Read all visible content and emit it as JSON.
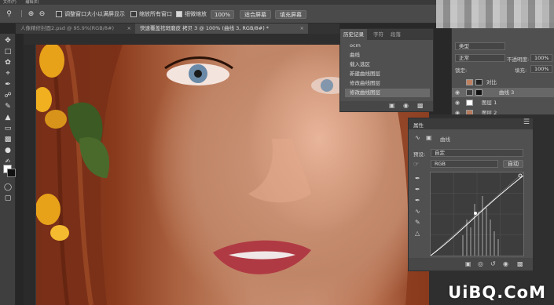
{
  "menubar": {
    "items": [
      "文件(F)",
      "编辑(E)"
    ]
  },
  "options": {
    "resize_windows_label": "调整窗口大小以满屏显示",
    "zoom_all_label": "缩放所有窗口",
    "scrubby_zoom_label": "细微缩放",
    "zoom_value": "100%",
    "fit_screen_label": "适合屏幕",
    "fill_screen_label": "填充屏幕"
  },
  "tabs": [
    {
      "label": "人像精修封面2.psd @ 95.9%(RGB/8#)",
      "close": "×"
    },
    {
      "label": "快速覆盖祛斑磨皮 拷贝 3 @ 100% (曲线 3, RGB/8#) *",
      "close": "×"
    }
  ],
  "history": {
    "tabs": [
      "历史记录",
      "字符",
      "段落"
    ],
    "rows": [
      "ocm",
      "曲线",
      "载入选区",
      "新建曲线图层",
      "修改曲线图层",
      "修改曲线图层"
    ],
    "active_index": 5
  },
  "layers": {
    "search_value": "类型",
    "blend_mode": "正常",
    "opacity_label": "不透明度:",
    "opacity_value": "100%",
    "lock_label": "锁定:",
    "fill_label": "填充:",
    "fill_value": "100%",
    "rows": [
      {
        "name": "对比",
        "visible": false
      },
      {
        "name": "曲线 3",
        "visible": true,
        "active": true
      },
      {
        "name": "图层 1",
        "visible": true
      },
      {
        "name": "图层 2",
        "visible": true
      }
    ]
  },
  "properties": {
    "title": "属性",
    "adjustment_label": "曲线",
    "preset_label": "预设:",
    "preset_value": "自定",
    "channel_value": "RGB",
    "auto_label": "自动"
  },
  "watermark": "UiBQ.CoM",
  "colors": {
    "panel_bg": "#505050",
    "options_bg": "#4a4a4a",
    "app_bg": "#282828",
    "foreground_swatch": "#ffffff",
    "background_swatch": "#111111"
  }
}
